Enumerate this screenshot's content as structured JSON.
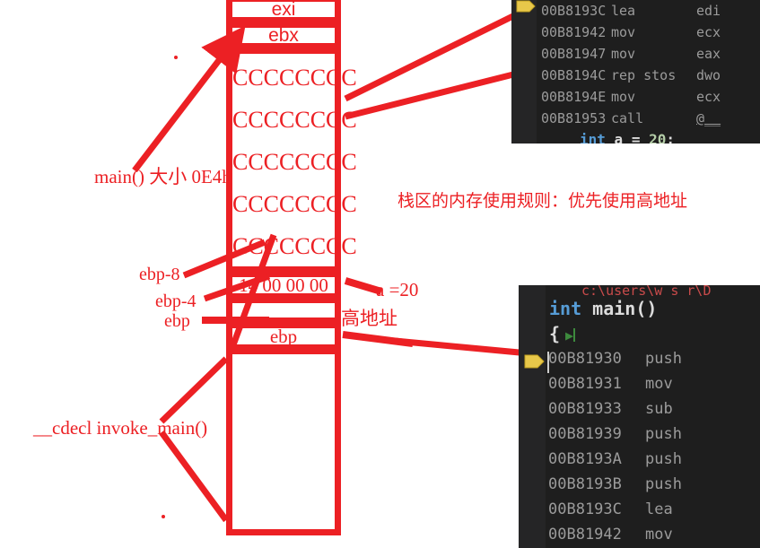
{
  "diagram": {
    "title_hint": "stack-frame-diagram",
    "accent_color": "#ec2024",
    "stack_cells": [
      {
        "name": "cell-esi",
        "label": "exi"
      },
      {
        "name": "cell-ebx",
        "label": "ebx"
      }
    ],
    "fill_pattern_rows": [
      "CCCCCCCC",
      "CCCCCCCC",
      "CCCCCCCC",
      "CCCCCCCC",
      "CCCCCCCC"
    ],
    "value_cell": "14 00 00 00",
    "ebp_cell": "ebp",
    "annotations": {
      "main_size": "main() 大小 0E4h",
      "ebp_minus_8": "ebp-8",
      "ebp_minus_4": "ebp-4",
      "ebp": "ebp",
      "cdecl_invoke_main": "__cdecl invoke_main()",
      "a_equals": "a =20",
      "high_address": "高地址",
      "stack_rule": "栈区的内存使用规则：优先使用高地址"
    }
  },
  "code_panel_top": {
    "name": "disassembly-panel-top",
    "lines": [
      {
        "addr": "00B8193C",
        "mnemonic": "lea",
        "operand": "edi"
      },
      {
        "addr": "00B81942",
        "mnemonic": "mov",
        "operand": "ecx"
      },
      {
        "addr": "00B81947",
        "mnemonic": "mov",
        "operand": "eax"
      },
      {
        "addr": "00B8194C",
        "mnemonic": "rep stos",
        "operand": "dwo"
      },
      {
        "addr": "00B8194E",
        "mnemonic": "mov",
        "operand": "ecx"
      },
      {
        "addr": "00B81953",
        "mnemonic": "call",
        "operand": "@__"
      }
    ],
    "source_line": {
      "keyword": "int",
      "identifier": "a",
      "operator": "=",
      "value": "20",
      "terminator": ";"
    }
  },
  "code_panel_bottom": {
    "name": "disassembly-panel-bottom",
    "path_line": "c:\\users\\w s r\\D",
    "signature": {
      "keyword": "int",
      "function": " main()"
    },
    "open_brace": "{",
    "lines": [
      {
        "addr": "00B81930",
        "mnemonic": "push"
      },
      {
        "addr": "00B81931",
        "mnemonic": "mov"
      },
      {
        "addr": "00B81933",
        "mnemonic": "sub"
      },
      {
        "addr": "00B81939",
        "mnemonic": "push"
      },
      {
        "addr": "00B8193A",
        "mnemonic": "push"
      },
      {
        "addr": "00B8193B",
        "mnemonic": "push"
      },
      {
        "addr": "00B8193C",
        "mnemonic": "lea"
      },
      {
        "addr": "00B81942",
        "mnemonic": "mov"
      }
    ]
  },
  "icons": {
    "play": "▶",
    "yellow_arrow": "current-execution-marker"
  }
}
